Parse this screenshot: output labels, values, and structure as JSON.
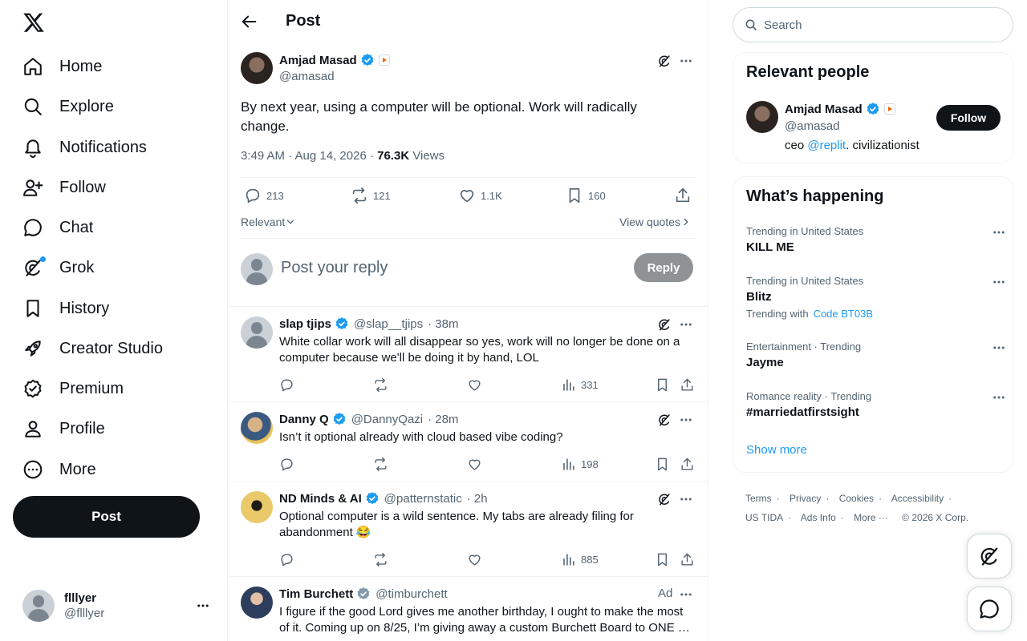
{
  "nav": {
    "items": [
      {
        "label": "Home",
        "icon": "home-icon"
      },
      {
        "label": "Explore",
        "icon": "search-icon"
      },
      {
        "label": "Notifications",
        "icon": "bell-icon"
      },
      {
        "label": "Follow",
        "icon": "person-add-icon"
      },
      {
        "label": "Chat",
        "icon": "chat-bubble-icon"
      },
      {
        "label": "Grok",
        "icon": "grok-icon"
      },
      {
        "label": "History",
        "icon": "bookmark-icon"
      },
      {
        "label": "Creator Studio",
        "icon": "rocket-icon"
      },
      {
        "label": "Premium",
        "icon": "verified-badge-icon"
      },
      {
        "label": "Profile",
        "icon": "person-icon"
      },
      {
        "label": "More",
        "icon": "more-circle-icon"
      }
    ],
    "post_label": "Post"
  },
  "account": {
    "name": "flllyer",
    "handle": "@flllyer"
  },
  "header": {
    "title": "Post"
  },
  "post": {
    "author": "Amjad Masad",
    "handle": "@amasad",
    "text": "By next year, using a computer will be optional. Work will radically change.",
    "time": "3:49 AM · Aug 14, 2026 · ",
    "views_count": "76.3K",
    "views_label": " Views",
    "replies": "213",
    "reposts": "121",
    "likes": "1.1K",
    "bookmarks": "160",
    "sort_label": "Relevant",
    "quotes_label": "View quotes"
  },
  "composer": {
    "placeholder": "Post your reply",
    "button": "Reply"
  },
  "replies": [
    {
      "name": "slap tjips",
      "handle": "@slap__tjips",
      "time": "· 38m",
      "text": "White collar work will all disappear so yes, work will no longer be done on a computer because we'll be doing it by hand, LOL",
      "views": "331",
      "badge": "blue"
    },
    {
      "name": "Danny Q",
      "handle": "@DannyQazi",
      "time": "· 28m",
      "text": "Isn’t it optional already with cloud based vibe coding?",
      "views": "198",
      "badge": "blue"
    },
    {
      "name": "ND Minds & AI",
      "handle": "@patternstatic",
      "time": "· 2h",
      "text": "Optional computer is a wild sentence. My tabs are already filing for abandonment 😂",
      "views": "885",
      "badge": "blue"
    },
    {
      "name": "Tim Burchett",
      "handle": "@timburchett",
      "time": "",
      "ad_label": "Ad",
      "text": "I figure if the good Lord gives me another birthday, I ought to make the most of it. Coming up on 8/25, I’m giving away a custom Burchett Board to ONE …",
      "badge": "gray"
    }
  ],
  "search": {
    "placeholder": "Search"
  },
  "relevant_people": {
    "title": "Relevant people",
    "name": "Amjad Masad",
    "handle": "@amasad",
    "bio_prefix": "ceo ",
    "bio_link": "@replit",
    "bio_suffix": ". civilizationist",
    "follow_label": "Follow"
  },
  "happening": {
    "title": "What’s happening",
    "trends": [
      {
        "context": "Trending in United States",
        "topic": "KILL ME"
      },
      {
        "context": "Trending in United States",
        "topic": "Blitz",
        "with_label": "Trending with",
        "with_link": "Code BT03B"
      },
      {
        "context": "Entertainment · Trending",
        "topic": "Jayme"
      },
      {
        "context": "Romance reality · Trending",
        "topic": "#marriedatfirstsight"
      }
    ],
    "show_more": "Show more"
  },
  "footer": {
    "links": [
      "Terms",
      "Privacy",
      "Cookies",
      "Accessibility",
      "US TIDA",
      "Ads Info",
      "More ···"
    ],
    "copyright": "© 2026 X Corp."
  },
  "colors": {
    "accent": "#1d9bf0",
    "text": "#0f1419",
    "muted": "#536471",
    "border": "#eff3f4"
  }
}
